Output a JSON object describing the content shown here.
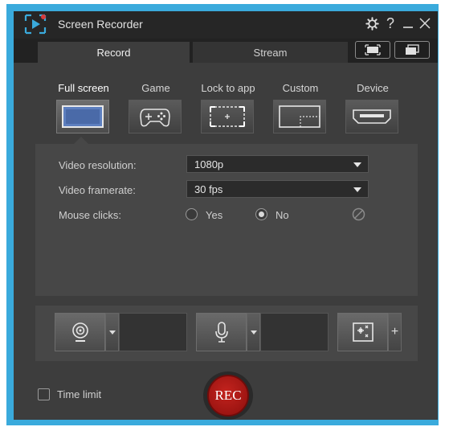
{
  "window": {
    "title": "Screen Recorder",
    "accent_color": "#3aaadc",
    "rec_color": "#b01a16"
  },
  "title_icons": [
    "gear-icon",
    "help-icon",
    "minimize-icon",
    "close-icon"
  ],
  "title_glyphs": {
    "help": "?"
  },
  "tabs": [
    {
      "label": "Record",
      "active": true
    },
    {
      "label": "Stream",
      "active": false
    }
  ],
  "modes": [
    {
      "label": "Full screen",
      "icon": "full-screen-icon",
      "active": true
    },
    {
      "label": "Game",
      "icon": "gamepad-icon",
      "active": false
    },
    {
      "label": "Lock to app",
      "icon": "lock-to-app-icon",
      "active": false
    },
    {
      "label": "Custom",
      "icon": "custom-region-icon",
      "active": false
    },
    {
      "label": "Device",
      "icon": "device-icon",
      "active": false
    }
  ],
  "settings": {
    "resolution_label": "Video resolution:",
    "resolution_value": "1080p",
    "framerate_label": "Video framerate:",
    "framerate_value": "30 fps",
    "mouse_label": "Mouse clicks:",
    "mouse_yes": "Yes",
    "mouse_no": "No",
    "mouse_selected": "No"
  },
  "devices": {
    "webcam_icon": "webcam-icon",
    "microphone_icon": "microphone-icon",
    "effects_icon": "effects-icon",
    "add_glyph": "+"
  },
  "footer": {
    "time_limit_label": "Time limit",
    "time_limit_checked": false,
    "rec_label": "REC"
  }
}
